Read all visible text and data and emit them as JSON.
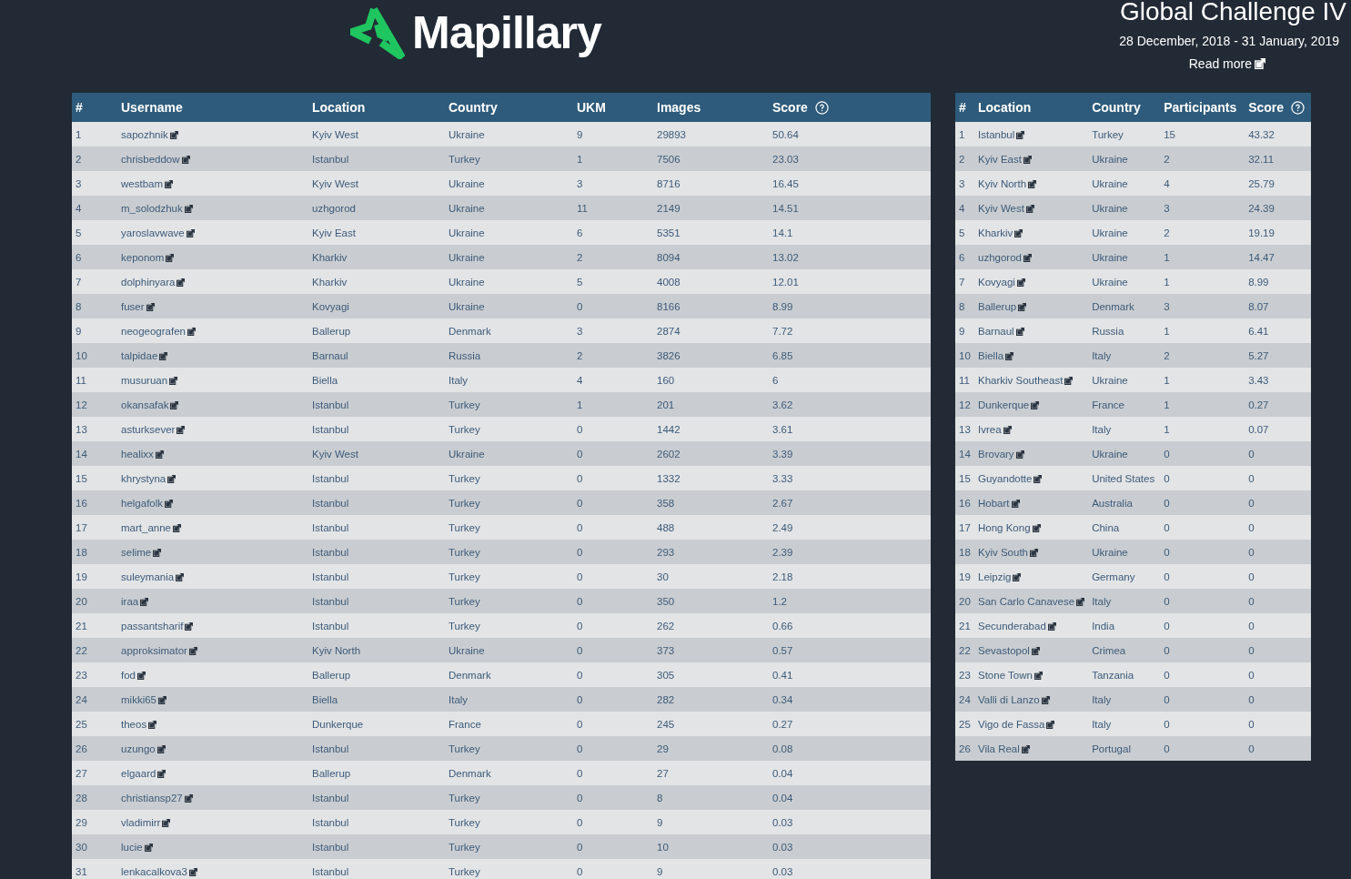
{
  "header": {
    "logo_text": "Mapillary",
    "title": "Global Challenge IV",
    "dates": "28 December, 2018 - 31 January, 2019",
    "read_more": "Read more"
  },
  "users_table": {
    "columns": [
      "#",
      "Username",
      "Location",
      "Country",
      "UKM",
      "Images",
      "Score"
    ],
    "rows": [
      [
        "1",
        "sapozhnik",
        "Kyiv West",
        "Ukraine",
        "9",
        "29893",
        "50.64"
      ],
      [
        "2",
        "chrisbeddow",
        "Istanbul",
        "Turkey",
        "1",
        "7506",
        "23.03"
      ],
      [
        "3",
        "westbam",
        "Kyiv West",
        "Ukraine",
        "3",
        "8716",
        "16.45"
      ],
      [
        "4",
        "m_solodzhuk",
        "uzhgorod",
        "Ukraine",
        "11",
        "2149",
        "14.51"
      ],
      [
        "5",
        "yaroslavwave",
        "Kyiv East",
        "Ukraine",
        "6",
        "5351",
        "14.1"
      ],
      [
        "6",
        "keponom",
        "Kharkiv",
        "Ukraine",
        "2",
        "8094",
        "13.02"
      ],
      [
        "7",
        "dolphinyara",
        "Kharkiv",
        "Ukraine",
        "5",
        "4008",
        "12.01"
      ],
      [
        "8",
        "fuser",
        "Kovyagi",
        "Ukraine",
        "0",
        "8166",
        "8.99"
      ],
      [
        "9",
        "neogeografen",
        "Ballerup",
        "Denmark",
        "3",
        "2874",
        "7.72"
      ],
      [
        "10",
        "talpidae",
        "Barnaul",
        "Russia",
        "2",
        "3826",
        "6.85"
      ],
      [
        "11",
        "musuruan",
        "Biella",
        "Italy",
        "4",
        "160",
        "6"
      ],
      [
        "12",
        "okansafak",
        "Istanbul",
        "Turkey",
        "1",
        "201",
        "3.62"
      ],
      [
        "13",
        "asturksever",
        "Istanbul",
        "Turkey",
        "0",
        "1442",
        "3.61"
      ],
      [
        "14",
        "healixx",
        "Kyiv West",
        "Ukraine",
        "0",
        "2602",
        "3.39"
      ],
      [
        "15",
        "khrystyna",
        "Istanbul",
        "Turkey",
        "0",
        "1332",
        "3.33"
      ],
      [
        "16",
        "helgafolk",
        "Istanbul",
        "Turkey",
        "0",
        "358",
        "2.67"
      ],
      [
        "17",
        "mart_anne",
        "Istanbul",
        "Turkey",
        "0",
        "488",
        "2.49"
      ],
      [
        "18",
        "selime",
        "Istanbul",
        "Turkey",
        "0",
        "293",
        "2.39"
      ],
      [
        "19",
        "suleymania",
        "Istanbul",
        "Turkey",
        "0",
        "30",
        "2.18"
      ],
      [
        "20",
        "iraa",
        "Istanbul",
        "Turkey",
        "0",
        "350",
        "1.2"
      ],
      [
        "21",
        "passantsharif",
        "Istanbul",
        "Turkey",
        "0",
        "262",
        "0.66"
      ],
      [
        "22",
        "approksimator",
        "Kyiv North",
        "Ukraine",
        "0",
        "373",
        "0.57"
      ],
      [
        "23",
        "fod",
        "Ballerup",
        "Denmark",
        "0",
        "305",
        "0.41"
      ],
      [
        "24",
        "mikki65",
        "Biella",
        "Italy",
        "0",
        "282",
        "0.34"
      ],
      [
        "25",
        "theos",
        "Dunkerque",
        "France",
        "0",
        "245",
        "0.27"
      ],
      [
        "26",
        "uzungo",
        "Istanbul",
        "Turkey",
        "0",
        "29",
        "0.08"
      ],
      [
        "27",
        "elgaard",
        "Ballerup",
        "Denmark",
        "0",
        "27",
        "0.04"
      ],
      [
        "28",
        "christiansp27",
        "Istanbul",
        "Turkey",
        "0",
        "8",
        "0.04"
      ],
      [
        "29",
        "vladimirr",
        "Istanbul",
        "Turkey",
        "0",
        "9",
        "0.03"
      ],
      [
        "30",
        "lucie",
        "Istanbul",
        "Turkey",
        "0",
        "10",
        "0.03"
      ],
      [
        "31",
        "lenkacalkova3",
        "Istanbul",
        "Turkey",
        "0",
        "9",
        "0.03"
      ]
    ]
  },
  "locations_table": {
    "columns": [
      "#",
      "Location",
      "Country",
      "Participants",
      "Score"
    ],
    "rows": [
      [
        "1",
        "Istanbul",
        "Turkey",
        "15",
        "43.32"
      ],
      [
        "2",
        "Kyiv East",
        "Ukraine",
        "2",
        "32.11"
      ],
      [
        "3",
        "Kyiv North",
        "Ukraine",
        "4",
        "25.79"
      ],
      [
        "4",
        "Kyiv West",
        "Ukraine",
        "3",
        "24.39"
      ],
      [
        "5",
        "Kharkiv",
        "Ukraine",
        "2",
        "19.19"
      ],
      [
        "6",
        "uzhgorod",
        "Ukraine",
        "1",
        "14.47"
      ],
      [
        "7",
        "Kovyagi",
        "Ukraine",
        "1",
        "8.99"
      ],
      [
        "8",
        "Ballerup",
        "Denmark",
        "3",
        "8.07"
      ],
      [
        "9",
        "Barnaul",
        "Russia",
        "1",
        "6.41"
      ],
      [
        "10",
        "Biella",
        "Italy",
        "2",
        "5.27"
      ],
      [
        "11",
        "Kharkiv Southeast",
        "Ukraine",
        "1",
        "3.43"
      ],
      [
        "12",
        "Dunkerque",
        "France",
        "1",
        "0.27"
      ],
      [
        "13",
        "Ivrea",
        "Italy",
        "1",
        "0.07"
      ],
      [
        "14",
        "Brovary",
        "Ukraine",
        "0",
        "0"
      ],
      [
        "15",
        "Guyandotte",
        "United States",
        "0",
        "0"
      ],
      [
        "16",
        "Hobart",
        "Australia",
        "0",
        "0"
      ],
      [
        "17",
        "Hong Kong",
        "China",
        "0",
        "0"
      ],
      [
        "18",
        "Kyiv South",
        "Ukraine",
        "0",
        "0"
      ],
      [
        "19",
        "Leipzig",
        "Germany",
        "0",
        "0"
      ],
      [
        "20",
        "San Carlo Canavese",
        "Italy",
        "0",
        "0"
      ],
      [
        "21",
        "Secunderabad",
        "India",
        "0",
        "0"
      ],
      [
        "22",
        "Sevastopol",
        "Crimea",
        "0",
        "0"
      ],
      [
        "23",
        "Stone Town",
        "Tanzania",
        "0",
        "0"
      ],
      [
        "24",
        "Valli di Lanzo",
        "Italy",
        "0",
        "0"
      ],
      [
        "25",
        "Vigo de Fassa",
        "Italy",
        "0",
        "0"
      ],
      [
        "26",
        "Vila Real",
        "Portugal",
        "0",
        "0"
      ]
    ]
  }
}
